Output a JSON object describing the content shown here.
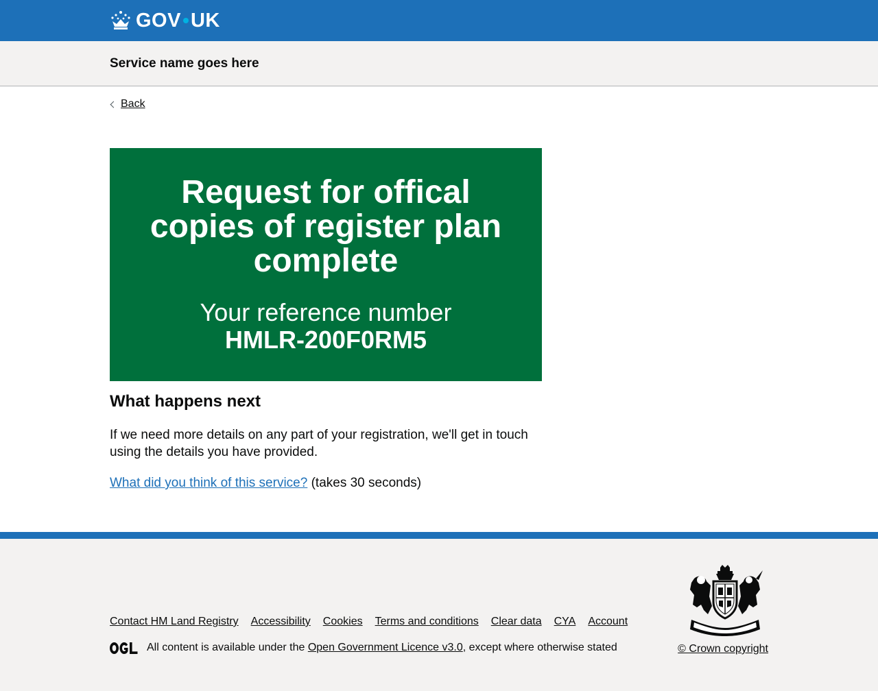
{
  "header": {
    "logo_text_left": "GOV",
    "logo_text_right": "UK",
    "service_name": "Service name goes here"
  },
  "nav": {
    "back_label": "Back"
  },
  "panel": {
    "title": "Request for offical copies of register plan complete",
    "body_label": "Your reference number",
    "reference": "HMLR-200F0RM5"
  },
  "content": {
    "next_heading": "What happens next",
    "next_body": "If we need more details on any part of your registration, we'll get in touch using the details you have provided.",
    "feedback_link": "What did you think of this service?",
    "feedback_suffix": " (takes 30 seconds)"
  },
  "footer": {
    "links": [
      "Contact HM Land Registry",
      "Accessibility",
      "Cookies",
      "Terms and conditions",
      "Clear data",
      "CYA",
      "Account"
    ],
    "licence_prefix": "All content is available under the ",
    "licence_link": "Open Government Licence v3.0",
    "licence_suffix": ", except where otherwise stated",
    "copyright": "© Crown copyright"
  },
  "colors": {
    "header_blue": "#1d70b8",
    "panel_green": "#00703c",
    "footer_grey": "#f3f2f1",
    "link_blue": "#1d70b8"
  },
  "icons": [
    "crown-icon",
    "chevron-left-icon",
    "ogl-logo-icon",
    "royal-coat-of-arms-icon"
  ]
}
